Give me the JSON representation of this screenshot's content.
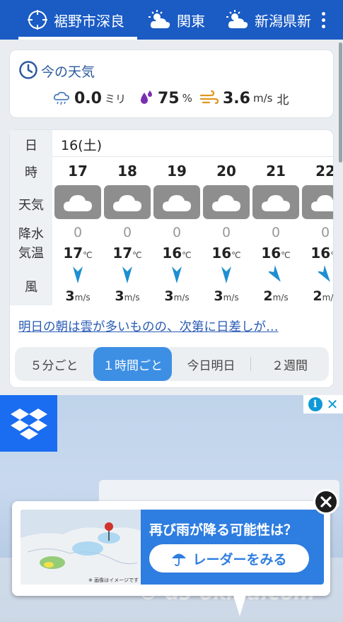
{
  "tabs": [
    {
      "label": "裾野市深良",
      "icon": "location-crosshair-icon",
      "selected": true
    },
    {
      "label": "関東",
      "icon": "sun-cloud-icon"
    },
    {
      "label": "新潟県新",
      "icon": "sun-cloud-icon"
    }
  ],
  "now": {
    "title": "今の天気",
    "rain_value": "0.0",
    "rain_unit": "ミリ",
    "humidity_value": "75",
    "humidity_unit": "%",
    "wind_value": "3.6",
    "wind_unit": "m/s",
    "wind_dir": "北"
  },
  "forecast": {
    "row_labels": {
      "day": "日",
      "hour": "時",
      "weather": "天気",
      "precip": "降水",
      "temp": "気温",
      "wind": "風"
    },
    "date": "16(土)",
    "columns": [
      {
        "hour": "17",
        "precip": "0",
        "temp": "17",
        "temp_unit": "℃",
        "wind": "3",
        "wind_unit": "m/s",
        "wind_dir": "north"
      },
      {
        "hour": "18",
        "precip": "0",
        "temp": "17",
        "temp_unit": "℃",
        "wind": "3",
        "wind_unit": "m/s",
        "wind_dir": "north"
      },
      {
        "hour": "19",
        "precip": "0",
        "temp": "16",
        "temp_unit": "℃",
        "wind": "3",
        "wind_unit": "m/s",
        "wind_dir": "north"
      },
      {
        "hour": "20",
        "precip": "0",
        "temp": "16",
        "temp_unit": "℃",
        "wind": "3",
        "wind_unit": "m/s",
        "wind_dir": "north"
      },
      {
        "hour": "21",
        "precip": "0",
        "temp": "16",
        "temp_unit": "℃",
        "wind": "2",
        "wind_unit": "m/s",
        "wind_dir": "north-east"
      },
      {
        "hour": "22",
        "precip": "0",
        "temp": "16",
        "temp_unit": "℃",
        "wind": "2",
        "wind_unit": "m/s",
        "wind_dir": "north-east"
      }
    ],
    "summary": "明日の朝は雲が多いものの、次第に日差しが…"
  },
  "segments": [
    "５分ごと",
    "１時間ごと",
    "今日明日",
    "２週間"
  ],
  "ad": {
    "question": "再び雨が降る可能性は？",
    "button": "レーダーをみる",
    "note": "※ 画像はイメージです",
    "watermark": "© ds-okina.com",
    "info_icon": "info-icon"
  },
  "colors": {
    "header": "#1a5bc4",
    "accent": "#3d8fe4",
    "link": "#2a5bb5",
    "weather_tile": "#8e8e8e",
    "arrow": "#1f8fd1"
  }
}
